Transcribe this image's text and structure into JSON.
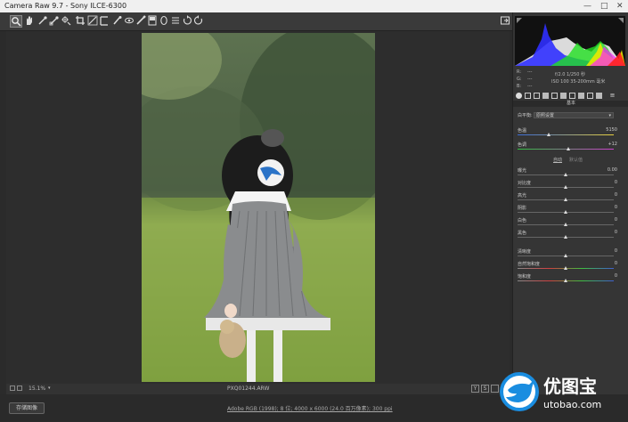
{
  "window": {
    "title": "Camera Raw 9.7 - Sony ILCE-6300",
    "minimize": "—",
    "maximize": "□",
    "close": "✕"
  },
  "toolbar": {
    "tools": [
      "zoom-icon",
      "hand-icon",
      "white-balance-icon",
      "color-sampler-icon",
      "targeted-adjust-icon",
      "crop-icon",
      "straighten-icon",
      "spot-removal-icon",
      "red-eye-icon",
      "adjustment-brush-icon",
      "graduated-filter-icon",
      "radial-filter-icon",
      "preferences-icon",
      "rotate-left-icon",
      "rotate-right-icon"
    ],
    "fullscreen_icon": "fullscreen-icon"
  },
  "histogram": {
    "colors": {
      "red": "#ff2020",
      "green": "#20e020",
      "blue": "#3030ff",
      "yellow": "#e8e800",
      "magenta": "#ff20ff",
      "white": "#ffffff"
    }
  },
  "info": {
    "r_label": "R:",
    "g_label": "G:",
    "b_label": "B:",
    "r_value": "---",
    "g_value": "---",
    "b_value": "---",
    "aperture_shutter": "f/2.0   1/250 秒",
    "iso_focal": "ISO 100   35-200mm 毫米"
  },
  "panel": {
    "header": "基本",
    "white_balance_label": "白平衡:",
    "white_balance_value": "原照设置",
    "auto_label": "自动",
    "default_label": "默认值"
  },
  "sliders": [
    {
      "label": "色温",
      "value": "5150",
      "pos": 0.32
    },
    {
      "label": "色调",
      "value": "+12",
      "pos": 0.53
    },
    {
      "label": "曝光",
      "value": "0.00",
      "pos": 0.5
    },
    {
      "label": "对比度",
      "value": "0",
      "pos": 0.5
    },
    {
      "label": "高光",
      "value": "0",
      "pos": 0.5
    },
    {
      "label": "阴影",
      "value": "0",
      "pos": 0.5
    },
    {
      "label": "白色",
      "value": "0",
      "pos": 0.5
    },
    {
      "label": "黑色",
      "value": "0",
      "pos": 0.5
    },
    {
      "label": "清晰度",
      "value": "0",
      "pos": 0.5
    },
    {
      "label": "自然饱和度",
      "value": "0",
      "pos": 0.5
    },
    {
      "label": "饱和度",
      "value": "0",
      "pos": 0.5
    }
  ],
  "bottombar": {
    "zoom": "15.1%",
    "filename": "PXQ01244.ARW",
    "y_button": "Y",
    "compare_button": "S"
  },
  "status": {
    "save_button": "存储图像",
    "workflow": "Adobe RGB (1998); 8 位; 4000 x 6000 (24.0 百万像素); 300 ppi"
  },
  "watermark": {
    "brand": "优图宝",
    "url": "utobao.com"
  }
}
